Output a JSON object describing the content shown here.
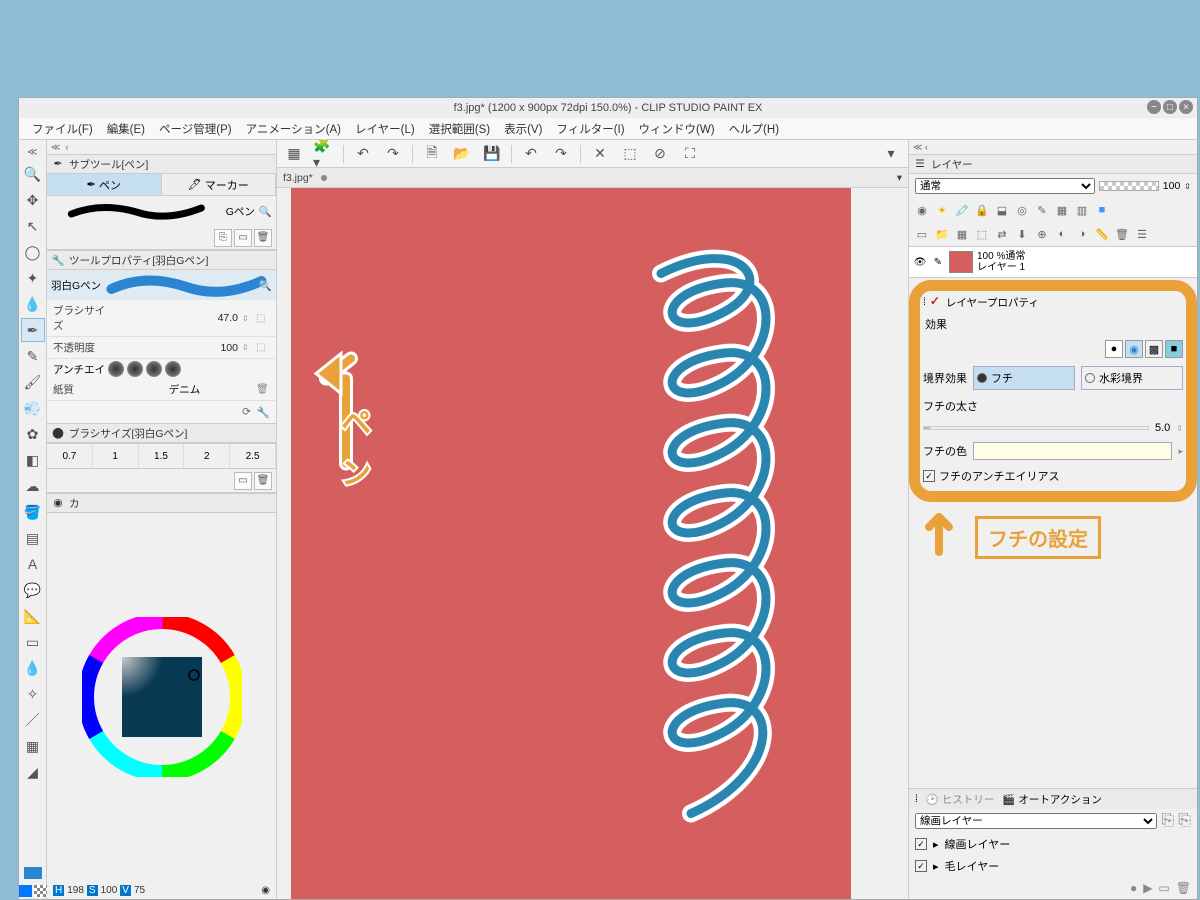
{
  "title": "f3.jpg* (1200 x 900px 72dpi 150.0%)  - CLIP STUDIO PAINT EX",
  "menu": [
    "ファイル(F)",
    "編集(E)",
    "ページ管理(P)",
    "アニメーション(A)",
    "レイヤー(L)",
    "選択範囲(S)",
    "表示(V)",
    "フィルター(I)",
    "ウィンドウ(W)",
    "ヘルプ(H)"
  ],
  "doc_tab": "f3.jpg*",
  "subtool": {
    "panel_title": "サブツール[ペン]",
    "tabs": [
      {
        "label": "ペン",
        "selected": true
      },
      {
        "label": "マーカー",
        "selected": false
      }
    ],
    "brush_name": "Gペン"
  },
  "toolprop": {
    "panel_title": "ツールプロパティ[羽白Gペン]",
    "name": "羽白Gペン",
    "brush_size_label": "ブラシサイズ",
    "brush_size": "47.0",
    "opacity_label": "不透明度",
    "opacity": "100",
    "aa_label": "アンチエイ",
    "paper_a": "紙質",
    "paper_b": "デニム"
  },
  "brush_presets": {
    "panel_title": "ブラシサイズ[羽白Gペン]",
    "values": [
      "0.7",
      "1",
      "1.5",
      "2",
      "2.5"
    ]
  },
  "color": {
    "panel_title": "カ",
    "readout_h": "198",
    "readout_s": "100",
    "readout_v": "75",
    "label_h": "H",
    "label_s": "S",
    "label_v": "V"
  },
  "layer": {
    "panel_title": "レイヤー",
    "blend_mode": "通常",
    "opacity": "100",
    "items": [
      {
        "name": "レイヤー 1",
        "info": "100 %通常"
      }
    ]
  },
  "layerprop": {
    "panel_title": "レイヤープロパティ",
    "section_effect": "効果",
    "border_effect_label": "境界効果",
    "opt_fuchi": "フチ",
    "opt_wc": "水彩境界",
    "thickness_label": "フチの太さ",
    "thickness": "5.0",
    "color_label": "フチの色",
    "color_value": "#fefee8",
    "aa_label": "フチのアンチエイリアス"
  },
  "autoaction": {
    "tab1": "ヒストリー",
    "tab2": "オートアクション",
    "set": "線画レイヤー",
    "items": [
      "線画レイヤー",
      "毛レイヤー"
    ]
  },
  "annotations": {
    "pen": "ペ\nン",
    "fuchi": "フチの設定"
  },
  "canvas_bg": "#d55e5e",
  "stroke_color": "#2a86b0",
  "stroke_outline": "#ffffff"
}
